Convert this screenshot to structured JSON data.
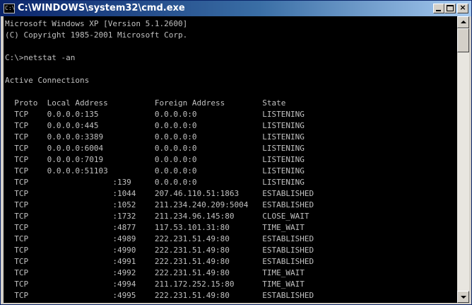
{
  "window": {
    "title": "C:\\WINDOWS\\system32\\cmd.exe",
    "icon_label": "C:\\"
  },
  "buttons": {
    "minimize": "minimize-icon",
    "maximize": "maximize-icon",
    "close": "close-icon",
    "close_glyph": "×"
  },
  "console": {
    "lines": [
      "Microsoft Windows XP [Version 5.1.2600]",
      "(C) Copyright 1985-2001 Microsoft Corp.",
      "",
      "C:\\>netstat -an",
      "",
      "Active Connections",
      "",
      "  Proto  Local Address          Foreign Address        State",
      "  TCP    0.0.0.0:135            0.0.0.0:0              LISTENING",
      "  TCP    0.0.0.0:445            0.0.0.0:0              LISTENING",
      "  TCP    0.0.0.0:3389           0.0.0.0:0              LISTENING",
      "  TCP    0.0.0.0:6004           0.0.0.0:0              LISTENING",
      "  TCP    0.0.0.0:7019           0.0.0.0:0              LISTENING",
      "  TCP    0.0.0.0:51103          0.0.0.0:0              LISTENING",
      "  TCP                  :139     0.0.0.0:0              LISTENING",
      "  TCP                  :1044    207.46.110.51:1863     ESTABLISHED",
      "  TCP                  :1052    211.234.240.209:5004   ESTABLISHED",
      "  TCP                  :1732    211.234.96.145:80      CLOSE_WAIT",
      "  TCP                  :4877    117.53.101.31:80       TIME_WAIT",
      "  TCP                  :4989    222.231.51.49:80       ESTABLISHED",
      "  TCP                  :4990    222.231.51.49:80       ESTABLISHED",
      "  TCP                  :4991    222.231.51.49:80       ESTABLISHED",
      "  TCP                  :4992    222.231.51.49:80       TIME_WAIT",
      "  TCP                  :4994    211.172.252.15:80      TIME_WAIT",
      "  TCP                  :4995    222.231.51.49:80       ESTABLISHED"
    ]
  },
  "colors": {
    "console_background": "#000000",
    "console_text": "#c0c0c0",
    "titlebar_start": "#0a246a",
    "titlebar_end": "#a6caf0"
  }
}
